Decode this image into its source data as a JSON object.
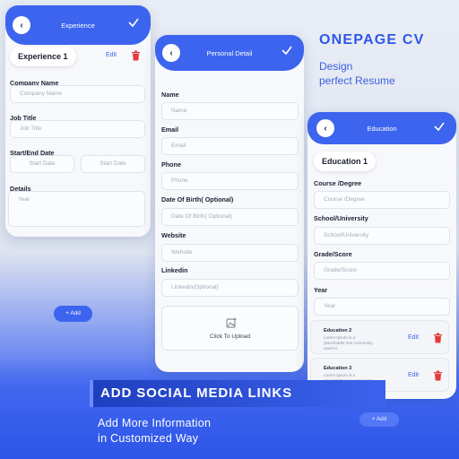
{
  "colors": {
    "accent": "#3c64ee",
    "danger": "#e53a3a",
    "text": "#1c2233",
    "placeholder": "#a4aab8"
  },
  "experience": {
    "header_title": "Experience",
    "pill": "Experience 1",
    "edit": "Edit",
    "company_label": "Company Name",
    "company_placeholder": "Company Name",
    "job_label": "Job Title",
    "job_placeholder": "Job Title",
    "dates_label": "Start/End Date",
    "start_placeholder": "Start  Date",
    "end_placeholder": "Start  Date",
    "details_label": "Details",
    "details_placeholder": "Year",
    "add_button": "+ Add"
  },
  "personal": {
    "header_title": "Personal Detail",
    "name_label": "Name",
    "name_placeholder": "Name",
    "email_label": "Email",
    "email_placeholder": "Email",
    "phone_label": "Phone",
    "phone_placeholder": "Phone",
    "dob_label": "Date Of Birth( Optional)",
    "dob_placeholder": "Date Of Birth( Optional)",
    "website_label": "Website",
    "website_placeholder": "Website",
    "linkedin_label": "Linkedin",
    "linkedin_placeholder": "Linkedin(Optional)",
    "upload_label": "Click To Upload"
  },
  "education": {
    "header_title": "Education",
    "pill": "Education 1",
    "course_label": "Course /Degree",
    "course_placeholder": "Course /Degree",
    "school_label": "School/University",
    "school_placeholder": "School/University",
    "grade_label": "Grade/Score",
    "grade_placeholder": "Grade/Score",
    "year_label": "Year",
    "year_placeholder": "Year",
    "items": [
      {
        "title": "Education 2",
        "desc": "Lorem Ipsum is a placeholder text commonly used to",
        "edit": "Edit"
      },
      {
        "title": "Education 3",
        "desc": "Lorem Ipsum is a placeholder text commonly used to",
        "edit": "Edit"
      }
    ],
    "add_button": "+ Add"
  },
  "promo": {
    "title": "ONEPAGE CV",
    "subtitle_line1": "Design",
    "subtitle_line2": "perfect Resume",
    "bottom_title": "ADD SOCIAL MEDIA LINKS",
    "bottom_sub_line1": "Add More Information",
    "bottom_sub_line2": "in Customized Way"
  }
}
